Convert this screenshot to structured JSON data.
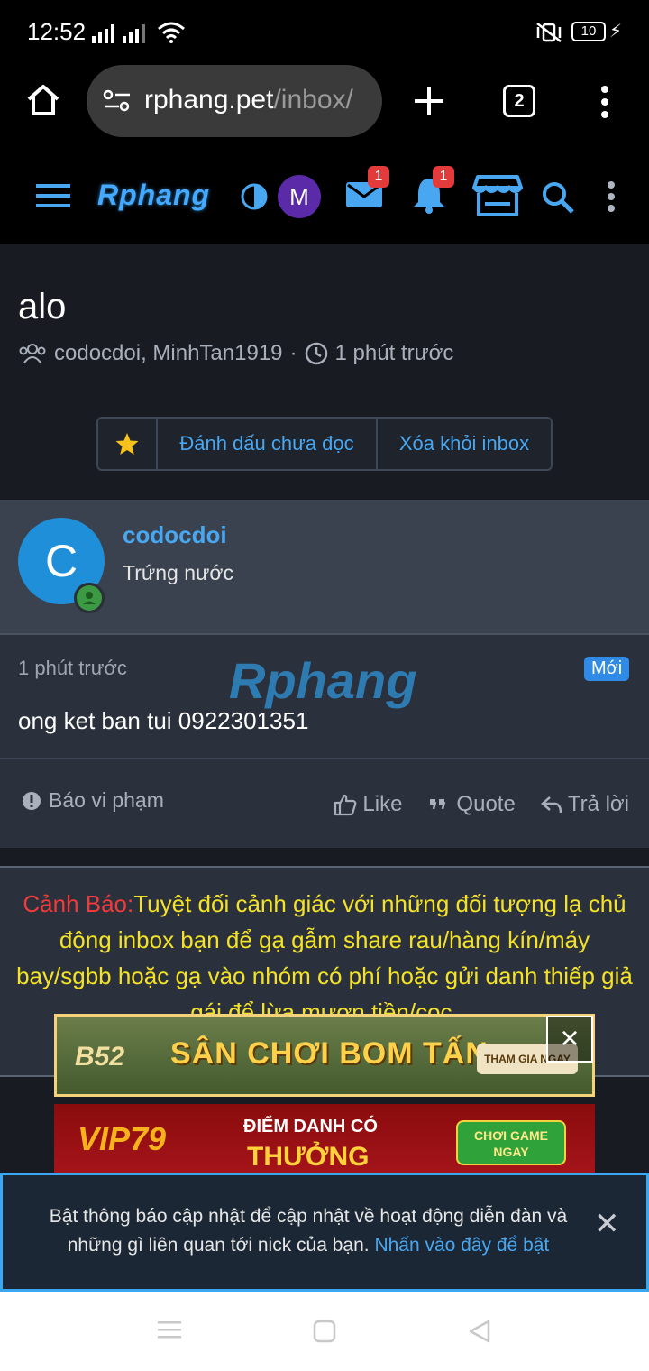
{
  "status": {
    "time": "12:52",
    "battery": "10"
  },
  "browser": {
    "url_main": "rphang.pet",
    "url_path": "/inbox/",
    "tab_count": "2"
  },
  "site": {
    "logo": "Rphang",
    "avatar_initial": "M",
    "inbox_badge": "1",
    "alerts_badge": "1"
  },
  "thread": {
    "title": "alo",
    "participants": "codocdoi, MinhTan1919",
    "time": "1 phút trước",
    "actions": {
      "mark_unread": "Đánh dấu chưa đọc",
      "remove": "Xóa khỏi inbox"
    }
  },
  "post": {
    "avatar_initial": "C",
    "username": "codocdoi",
    "user_title": "Trứng nước",
    "time": "1 phút trước",
    "new_badge": "Mới",
    "watermark": "Rphang",
    "message": "ong ket ban tui 0922301351",
    "report": "Báo vi phạm",
    "like": "Like",
    "quote": "Quote",
    "reply": "Trả lời"
  },
  "warning": {
    "label": "Cảnh Báo:",
    "text": "Tuyệt đối cảnh giác với những đối tượng lạ chủ động inbox bạn để gạ gẫm share rau/hàng kín/máy bay/sgbb hoặc gạ vào nhóm có phí hoặc gửi danh thiếp giả gái để lừa mượn tiền/cọc."
  },
  "ads": {
    "ad1": {
      "brand": "B52",
      "headline": "SÂN CHƠI BOM TẤN",
      "cta": "THAM GIA NGAY"
    },
    "ad2": {
      "brand": "VIP79",
      "line1": "ĐIỂM DANH CÓ",
      "line2": "THƯỞNG",
      "cta": "CHƠI GAME NGAY"
    }
  },
  "notice": {
    "text": "Bật thông báo cập nhật để cập nhật về hoạt động diễn đàn và những gì liên quan tới nick của bạn.",
    "link": "Nhấn vào đây để bật"
  },
  "colors": {
    "accent": "#48a7f0",
    "warning_red": "#f23a3a",
    "warning_yellow": "#f4e229",
    "new_badge": "#2f8be6"
  }
}
